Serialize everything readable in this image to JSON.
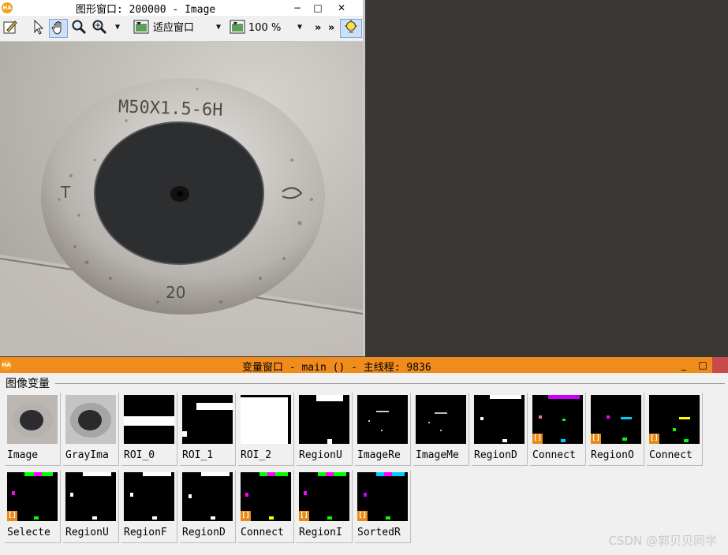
{
  "graphics_window": {
    "title": "图形窗口: 200000 - Image",
    "window_buttons": {
      "minimize": "−",
      "maximize": "□",
      "close": "✕"
    },
    "toolbar": {
      "fit_window_label": "适应窗口",
      "zoom_value": "100 %",
      "overflow": "»",
      "overflow2": "»"
    },
    "image": {
      "stamp_text": "M50X1.5-6H",
      "left_mark": "T",
      "number_mark": "20"
    }
  },
  "variable_window": {
    "title": "变量窗口 - main () - 主线程: 9836",
    "section_label": "图像变量",
    "window_buttons": {
      "minimize": "_",
      "maximize": "□"
    },
    "items": [
      {
        "label": "Image",
        "kind": "photo"
      },
      {
        "label": "GrayIma",
        "kind": "gray"
      },
      {
        "label": "ROI_0",
        "kind": "roi0"
      },
      {
        "label": "ROI_1",
        "kind": "roi1"
      },
      {
        "label": "ROI_2",
        "kind": "roi2"
      },
      {
        "label": "RegionU",
        "kind": "regionu"
      },
      {
        "label": "ImageRe",
        "kind": "imagere"
      },
      {
        "label": "ImageMe",
        "kind": "imageme"
      },
      {
        "label": "RegionD",
        "kind": "regiond"
      },
      {
        "label": "Connect",
        "kind": "connect"
      },
      {
        "label": "RegionO",
        "kind": "regiono"
      },
      {
        "label": "Connect",
        "kind": "connect2"
      },
      {
        "label": "Selecte",
        "kind": "selecte"
      },
      {
        "label": "RegionU",
        "kind": "regionu2"
      },
      {
        "label": "RegionF",
        "kind": "regionf"
      },
      {
        "label": "RegionD",
        "kind": "regiond2"
      },
      {
        "label": "Connect",
        "kind": "connect3"
      },
      {
        "label": "RegionI",
        "kind": "regioni"
      },
      {
        "label": "SortedR",
        "kind": "sortedr"
      }
    ],
    "badge_glyph": "[]"
  },
  "watermark": "CSDN @郭贝贝同学"
}
